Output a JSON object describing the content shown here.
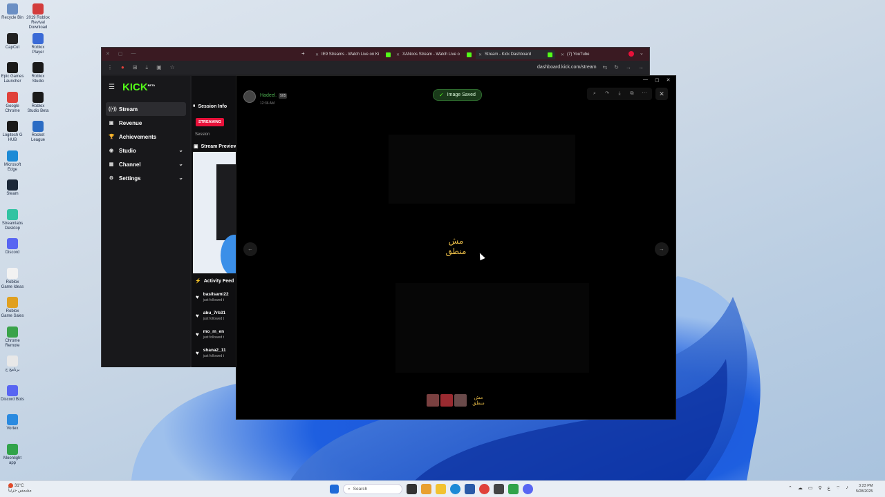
{
  "desktop": {
    "icons": [
      {
        "label": "Recycle Bin",
        "color": "#6b8fc4"
      },
      {
        "label": "2019 Roblox Revival Download",
        "color": "#d33c3c"
      },
      {
        "label": "CapCut",
        "color": "#222222"
      },
      {
        "label": "Roblox Player",
        "color": "#3a6ad6"
      },
      {
        "label": "Epic Games Launcher",
        "color": "#1a1a1a"
      },
      {
        "label": "Roblox Studio",
        "color": "#1a1a1a"
      },
      {
        "label": "Google Chrome",
        "color": "#e0413a"
      },
      {
        "label": "Roblox Studio Beta",
        "color": "#1a1a1a"
      },
      {
        "label": "Logitech G HUB",
        "color": "#1a1a1a"
      },
      {
        "label": "Rocket League",
        "color": "#2b6cc4"
      },
      {
        "label": "Microsoft Edge",
        "color": "#1c8ad6"
      },
      {
        "label": "Steam",
        "color": "#1b2838"
      },
      {
        "label": "Streamlabs Desktop",
        "color": "#31c3a2"
      },
      {
        "label": "Discord",
        "color": "#5865f2"
      },
      {
        "label": "Roblox Game Ideas",
        "color": "#f2f2f2"
      },
      {
        "label": "Roblox Game Sales",
        "color": "#e0a020"
      },
      {
        "label": "Chrome Remote",
        "color": "#3aa34a"
      },
      {
        "label": "برنامج ج",
        "color": "#e8e8e8"
      },
      {
        "label": "Discord Bots",
        "color": "#5865f2"
      },
      {
        "label": "Vortex",
        "color": "#2a8ae0"
      },
      {
        "label": "Moonlight app",
        "color": "#31a34a"
      }
    ]
  },
  "browser": {
    "tabs": [
      {
        "label": "Stream - Kick Dashboard",
        "active": true
      },
      {
        "label": "IE9 Streams - Watch Live on Ki",
        "active": false
      },
      {
        "label": "XANoos Stream - Watch Live o",
        "active": false
      },
      {
        "label": "(7) YouTube",
        "active": false
      }
    ],
    "url": "dashboard.kick.com/stream"
  },
  "kick": {
    "logo": "KICK",
    "logo_sup": "BETA",
    "nav": [
      {
        "label": "Stream",
        "icon": "((•))",
        "active": true,
        "chevron": false
      },
      {
        "label": "Revenue",
        "icon": "▣",
        "active": false,
        "chevron": false
      },
      {
        "label": "Achievements",
        "icon": "🏆",
        "active": false,
        "chevron": false
      },
      {
        "label": "Studio",
        "icon": "◉",
        "active": false,
        "chevron": true
      },
      {
        "label": "Channel",
        "icon": "▦",
        "active": false,
        "chevron": true
      },
      {
        "label": "Settings",
        "icon": "⚙",
        "active": false,
        "chevron": true
      }
    ],
    "session_info": "Session Info",
    "streaming_badge": "STREAMING",
    "session_label": "Session",
    "stream_preview": "Stream Preview",
    "activity_feed": "Activity Feed",
    "activity": [
      {
        "name": "basilsami22",
        "sub": "just followed t"
      },
      {
        "name": "abu_7rb31",
        "sub": "just followed t"
      },
      {
        "name": "mo_m_en",
        "sub": "just followed t"
      },
      {
        "name": "shana2_11",
        "sub": "just followed t"
      }
    ]
  },
  "viewer": {
    "user_name": "Hadeel.",
    "badge": "505",
    "time": "12:36 AM",
    "toast": "Image Saved",
    "caption_line1": "مش",
    "caption_line2": "منطق",
    "thumb_caption_line1": "مش",
    "thumb_caption_line2": "منطق",
    "tools": [
      "zoom-icon",
      "rotate-icon",
      "download-icon",
      "open-external-icon",
      "more-icon"
    ]
  },
  "taskbar": {
    "temp": "31°C",
    "weather_text": "مشمس جزئياً",
    "search_placeholder": "Search",
    "time": "3:23 PM",
    "date": "5/28/2025"
  }
}
